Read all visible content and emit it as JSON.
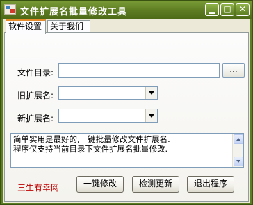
{
  "window": {
    "title": "文件扩展名批量修改工具",
    "controls": {
      "minimize": "▁",
      "maximize": "□",
      "close": "✕"
    }
  },
  "tabs": [
    {
      "label": "软件设置",
      "active": true
    },
    {
      "label": "关于我们",
      "active": false
    }
  ],
  "form": {
    "dir_label": "文件目录:",
    "dir_value": "",
    "browse_label": "...",
    "old_ext_label": "旧扩展名:",
    "old_ext_value": "",
    "new_ext_label": "新扩展名:",
    "new_ext_value": ""
  },
  "memo": {
    "lines": [
      "简单实用是最好的,一键批量修改文件扩展名.",
      "程序仅支持当前目录下文件扩展名批量修改."
    ]
  },
  "footer": {
    "link_text": "三生有幸网",
    "buttons": {
      "run": "一键修改",
      "update": "检测更新",
      "exit": "退出程序"
    }
  },
  "colors": {
    "titlebar": "#5e7e23",
    "client_bg": "#ece9d8",
    "tab_accent": "#e68b2c",
    "link": "#c00000"
  },
  "icons": {
    "app": "app-icon",
    "dropdown": "chevron-down-icon",
    "scroll_up": "arrow-up-icon",
    "scroll_down": "arrow-down-icon"
  }
}
